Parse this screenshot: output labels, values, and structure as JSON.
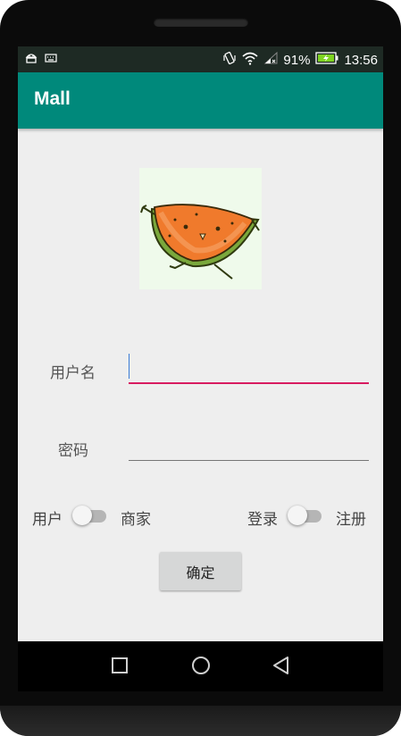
{
  "status_bar": {
    "battery_percent": "91%",
    "time": "13:56",
    "icons": [
      "android-debug-icon",
      "keyboard-icon",
      "vibrate-icon",
      "wifi-icon",
      "signal-icon",
      "battery-charging-icon"
    ]
  },
  "appbar": {
    "title": "Mall"
  },
  "form": {
    "username_label": "用户名",
    "password_label": "密码",
    "username_value": "",
    "password_value": ""
  },
  "role_switch": {
    "left_label": "用户",
    "right_label": "商家",
    "checked": false
  },
  "mode_switch": {
    "left_label": "登录",
    "right_label": "注册",
    "checked": false
  },
  "confirm_button": {
    "label": "确定"
  },
  "colors": {
    "primary": "#00897b",
    "accent_underline": "#d81b60",
    "background": "#eeeeee"
  },
  "navbar": {
    "icons": [
      "recents-icon",
      "home-icon",
      "back-icon"
    ]
  }
}
